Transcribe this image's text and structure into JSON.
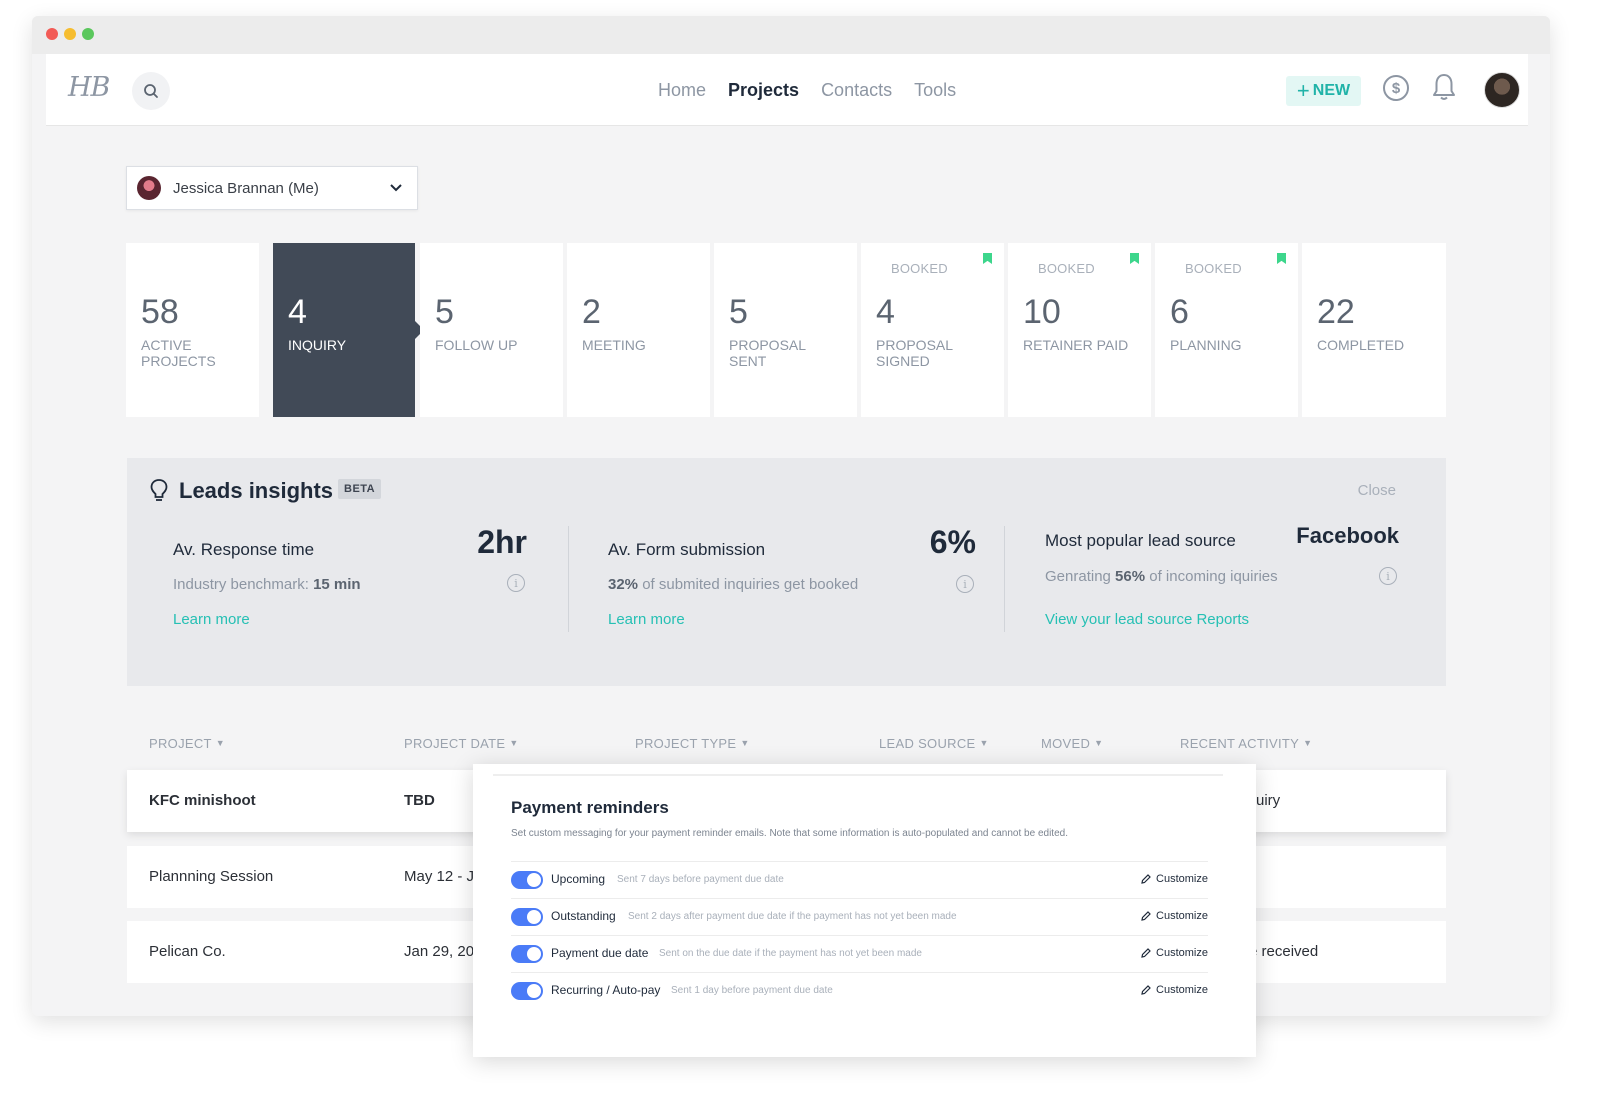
{
  "logo": "HB",
  "nav": {
    "links": [
      "Home",
      "Projects",
      "Contacts",
      "Tools"
    ],
    "new_label": "NEW",
    "dollar_glyph": "$"
  },
  "user_select": {
    "value": "Jessica Brannan (Me)"
  },
  "stages": [
    {
      "count": "58",
      "label": "ACTIVE PROJECTS",
      "booked": "",
      "active": false
    },
    {
      "count": "4",
      "label": "INQUIRY",
      "booked": "",
      "active": true
    },
    {
      "count": "5",
      "label": "FOLLOW UP",
      "booked": "",
      "active": false
    },
    {
      "count": "2",
      "label": "MEETING",
      "booked": "",
      "active": false
    },
    {
      "count": "5",
      "label": "PROPOSAL SENT",
      "booked": "",
      "active": false
    },
    {
      "count": "4",
      "label": "PROPOSAL SIGNED",
      "booked": "BOOKED",
      "active": false
    },
    {
      "count": "10",
      "label": "RETAINER PAID",
      "booked": "BOOKED",
      "active": false
    },
    {
      "count": "6",
      "label": "PLANNING",
      "booked": "BOOKED",
      "active": false
    },
    {
      "count": "22",
      "label": "COMPLETED",
      "booked": "",
      "active": false
    }
  ],
  "insights": {
    "title": "Leads insights",
    "beta": "BETA",
    "close": "Close",
    "response": {
      "label": "Av. Response time",
      "value": "2hr",
      "sub_prefix": "Industry benchmark: ",
      "sub_bold": "15 min",
      "link": "Learn more"
    },
    "form": {
      "label": "Av. Form submission",
      "value": "6%",
      "sub_bold": "32%",
      "sub_suffix": " of submited inquiries get booked",
      "link": "Learn more"
    },
    "source": {
      "label": "Most popular lead source",
      "value": "Facebook",
      "sub_prefix": "Genrating ",
      "sub_bold": "56%",
      "sub_suffix": " of incoming iquiries",
      "link": "View your lead source Reports"
    }
  },
  "table": {
    "headers": [
      "PROJECT",
      "PROJECT DATE",
      "PROJECT TYPE",
      "LEAD SOURCE",
      "MOVED",
      "RECENT ACTIVITY"
    ],
    "rows": [
      {
        "project": "KFC minishoot",
        "date": "TBD",
        "activity": "uiry"
      },
      {
        "project": "Plannning Session",
        "date": "May 12 - J",
        "activity": ""
      },
      {
        "project": "Pelican Co.",
        "date": "Jan 29, 20",
        "activity": "e received"
      }
    ]
  },
  "modal": {
    "title": "Payment reminders",
    "desc": "Set custom messaging for your payment reminder emails. Note that some information is auto-populated and cannot be edited.",
    "customize_label": "Customize",
    "reminders": [
      {
        "name": "Upcoming",
        "desc": "Sent 7 days before payment due date",
        "enabled": true
      },
      {
        "name": "Outstanding",
        "desc": "Sent 2 days after payment due date if the payment has not yet been made",
        "enabled": true
      },
      {
        "name": "Payment due date",
        "desc": "Sent on the due date if the payment has not yet been made",
        "enabled": true
      },
      {
        "name": "Recurring / Auto-pay",
        "desc": "Sent 1 day before payment due date",
        "enabled": true
      }
    ]
  },
  "colors": {
    "accent_teal": "#26c0b4",
    "active_stage": "#414a57",
    "toggle_blue": "#4a7bf7",
    "bookmark_green": "#3dd68c"
  }
}
